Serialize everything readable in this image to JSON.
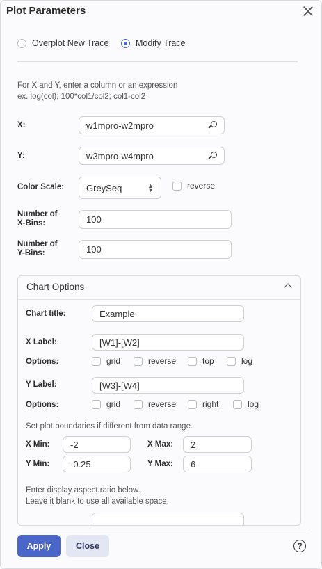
{
  "dialog": {
    "title": "Plot Parameters"
  },
  "trace_mode": {
    "options": [
      "Overplot New Trace",
      "Modify Trace"
    ],
    "selected": "Modify Trace"
  },
  "hints": {
    "xy_line1": "For X and Y, enter a column or an expression",
    "xy_line2": "ex. log(col); 100*col1/col2; col1-col2"
  },
  "fields": {
    "x": {
      "label": "X:",
      "value": "w1mpro-w2mpro"
    },
    "y": {
      "label": "Y:",
      "value": "w3mpro-w4mpro"
    },
    "color_scale": {
      "label": "Color Scale:",
      "value": "GreySeq",
      "reverse_label": "reverse"
    },
    "x_bins": {
      "label_line1": "Number of",
      "label_line2": "X-Bins:",
      "value": "100"
    },
    "y_bins": {
      "label_line1": "Number of",
      "label_line2": "Y-Bins:",
      "value": "100"
    }
  },
  "chart_options": {
    "title": "Chart Options",
    "chart_title": {
      "label": "Chart title:",
      "value": "Example"
    },
    "x_label": {
      "label": "X Label:",
      "value": "[W1]-[W2]"
    },
    "x_options": {
      "label": "Options:",
      "items": [
        "grid",
        "reverse",
        "top",
        "log"
      ]
    },
    "y_label": {
      "label": "Y Label:",
      "value": "[W3]-[W4]"
    },
    "y_options": {
      "label": "Options:",
      "items": [
        "grid",
        "reverse",
        "right",
        "log"
      ]
    },
    "boundaries_hint": "Set plot boundaries if different from data range.",
    "x_min": {
      "label": "X Min:",
      "value": "-2"
    },
    "x_max": {
      "label": "X Max:",
      "value": "2"
    },
    "y_min": {
      "label": "Y Min:",
      "value": "-0.25"
    },
    "y_max": {
      "label": "Y Max:",
      "value": "6"
    },
    "aspect_hint_line1": "Enter display aspect ratio below.",
    "aspect_hint_line2": "Leave it blank to use all available space."
  },
  "footer": {
    "apply": "Apply",
    "close": "Close",
    "help": "?"
  }
}
